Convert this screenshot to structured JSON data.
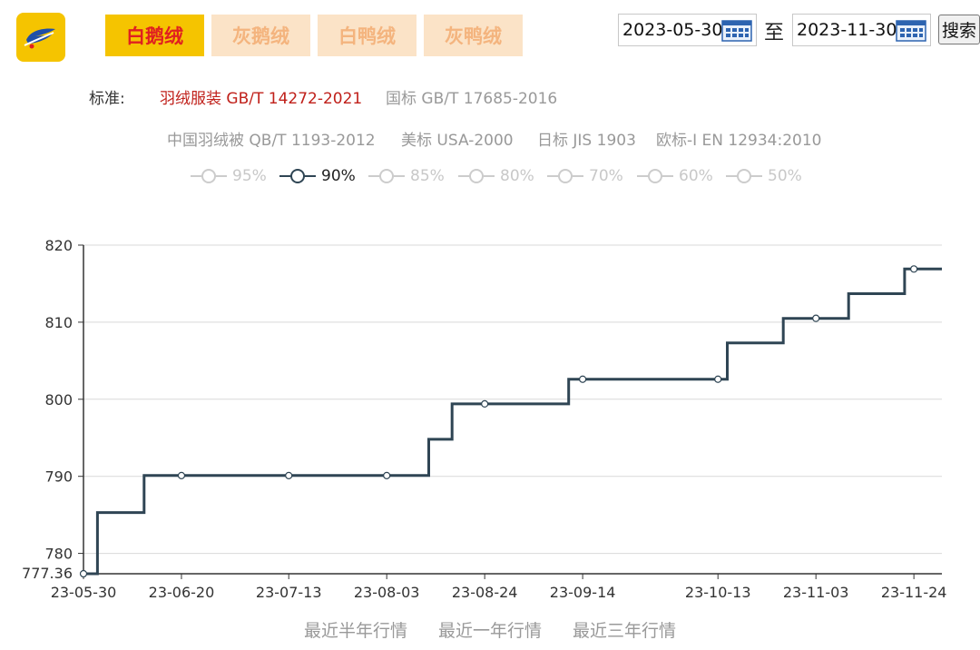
{
  "logo": {
    "icon": "feather-logo-icon",
    "color": "#f5c400"
  },
  "category_tabs": [
    {
      "label": "白鹅绒",
      "active": true
    },
    {
      "label": "灰鹅绒",
      "active": false
    },
    {
      "label": "白鸭绒",
      "active": false
    },
    {
      "label": "灰鸭绒",
      "active": false
    }
  ],
  "date_range": {
    "start": "2023-05-30",
    "separator": "至",
    "end": "2023-11-30",
    "search_label": "搜索"
  },
  "standards": {
    "label": "标准:",
    "items": [
      {
        "label": "羽绒服装 GB/T 14272-2021",
        "active": true
      },
      {
        "label": "国标 GB/T 17685-2016",
        "active": false
      },
      {
        "label": "中国羽绒被 QB/T 1193-2012",
        "active": false
      },
      {
        "label": "美标 USA-2000",
        "active": false
      },
      {
        "label": "日标 JIS 1903",
        "active": false
      },
      {
        "label": "欧标-I EN 12934:2010",
        "active": false
      }
    ]
  },
  "percentages": [
    {
      "label": "95%",
      "active": false
    },
    {
      "label": "90%",
      "active": true
    },
    {
      "label": "85%",
      "active": false
    },
    {
      "label": "80%",
      "active": false
    },
    {
      "label": "70%",
      "active": false
    },
    {
      "label": "60%",
      "active": false
    },
    {
      "label": "50%",
      "active": false
    }
  ],
  "chart_data": {
    "type": "line",
    "line_style": "step",
    "x_ticks": [
      "23-05-30",
      "23-06-20",
      "23-07-13",
      "23-08-03",
      "23-08-24",
      "23-09-14",
      "23-10-13",
      "23-11-03",
      "23-11-24"
    ],
    "y_ticks": [
      780,
      790,
      800,
      810,
      820
    ],
    "y_min_label": "777.36",
    "ylim": [
      777.36,
      820
    ],
    "xlim": [
      "2023-05-30",
      "2023-11-30"
    ],
    "series": [
      {
        "color": "#2f4554",
        "points": [
          {
            "x": "2023-05-30",
            "y": 777.36,
            "marker": true
          },
          {
            "x": "2023-06-02",
            "y": 777.36
          },
          {
            "x": "2023-06-02",
            "y": 785.3
          },
          {
            "x": "2023-06-12",
            "y": 785.3
          },
          {
            "x": "2023-06-12",
            "y": 790.1
          },
          {
            "x": "2023-06-20",
            "y": 790.1,
            "marker": true
          },
          {
            "x": "2023-07-13",
            "y": 790.1,
            "marker": true
          },
          {
            "x": "2023-08-03",
            "y": 790.1,
            "marker": true
          },
          {
            "x": "2023-08-12",
            "y": 790.1
          },
          {
            "x": "2023-08-12",
            "y": 794.8
          },
          {
            "x": "2023-08-17",
            "y": 794.8
          },
          {
            "x": "2023-08-17",
            "y": 799.4
          },
          {
            "x": "2023-08-24",
            "y": 799.4,
            "marker": true
          },
          {
            "x": "2023-09-11",
            "y": 799.4
          },
          {
            "x": "2023-09-11",
            "y": 802.6
          },
          {
            "x": "2023-09-14",
            "y": 802.6,
            "marker": true
          },
          {
            "x": "2023-10-13",
            "y": 802.6,
            "marker": true
          },
          {
            "x": "2023-10-15",
            "y": 802.6
          },
          {
            "x": "2023-10-15",
            "y": 807.3
          },
          {
            "x": "2023-10-27",
            "y": 807.3
          },
          {
            "x": "2023-10-27",
            "y": 810.5
          },
          {
            "x": "2023-11-03",
            "y": 810.5,
            "marker": true
          },
          {
            "x": "2023-11-10",
            "y": 810.5
          },
          {
            "x": "2023-11-10",
            "y": 813.7
          },
          {
            "x": "2023-11-22",
            "y": 813.7
          },
          {
            "x": "2023-11-22",
            "y": 816.9
          },
          {
            "x": "2023-11-24",
            "y": 816.9,
            "marker": true
          },
          {
            "x": "2023-11-30",
            "y": 816.9
          }
        ]
      }
    ],
    "grid": true,
    "grid_color": "#d9d9d9"
  },
  "range_options": [
    "最近半年行情",
    "最近一年行情",
    "最近三年行情"
  ]
}
